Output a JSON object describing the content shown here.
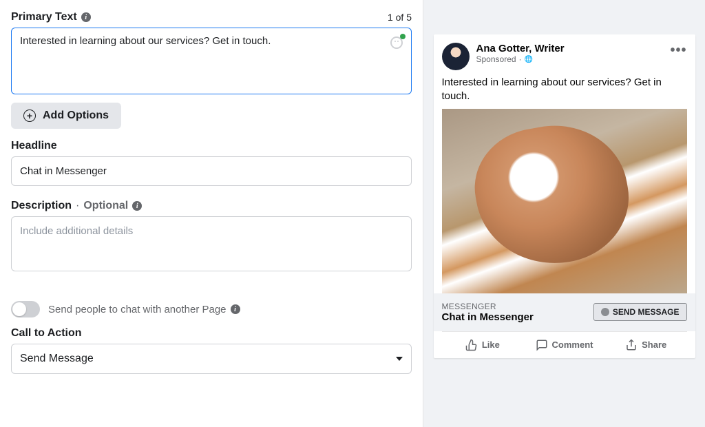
{
  "form": {
    "primaryText": {
      "label": "Primary Text",
      "counter": "1 of 5",
      "value": "Interested in learning about our services? Get in touch."
    },
    "addOptions": "Add Options",
    "headline": {
      "label": "Headline",
      "value": "Chat in Messenger"
    },
    "description": {
      "label": "Description",
      "optional": "Optional",
      "placeholder": "Include additional details"
    },
    "chatToggle": {
      "label": "Send people to chat with another Page"
    },
    "cta": {
      "label": "Call to Action",
      "value": "Send Message"
    }
  },
  "preview": {
    "pageName": "Ana Gotter, Writer",
    "sponsored": "Sponsored",
    "bodyText": "Interested in learning about our services? Get in touch.",
    "ctaOverline": "MESSENGER",
    "ctaHeadline": "Chat in Messenger",
    "ctaButton": "SEND MESSAGE",
    "social": {
      "like": "Like",
      "comment": "Comment",
      "share": "Share"
    }
  }
}
